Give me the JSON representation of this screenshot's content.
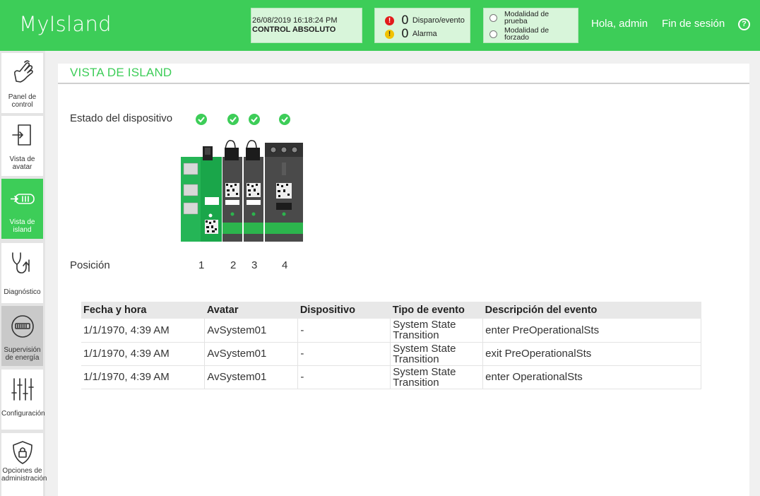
{
  "header": {
    "app_title": "MyIsland",
    "datetime": "26/08/2019 16:18:24 PM",
    "control_mode": "CONTROL ABSOLUTO",
    "trip_count": "0",
    "trip_label": "Disparo/evento",
    "alarm_count": "0",
    "alarm_label": "Alarma",
    "test_mode_label": "Modalidad de prueba",
    "forced_mode_label": "Modalidad de forzado",
    "greeting": "Hola, admin",
    "logout_label": "Fin de sesión",
    "help_icon": "?",
    "colors": {
      "brand": "#3dcd58",
      "trip": "#e21b1b",
      "alarm": "#f2c200"
    }
  },
  "sidebar": {
    "items": [
      {
        "label": "Panel de control",
        "icon": "hand-pointer-icon"
      },
      {
        "label": "Vista de avatar",
        "icon": "enter-door-icon"
      },
      {
        "label": "Vista de island",
        "icon": "island-module-icon",
        "active": true
      },
      {
        "label": "Diagnóstico",
        "icon": "stethoscope-icon"
      },
      {
        "label": "Supervisión de energía",
        "icon": "energy-meter-icon"
      },
      {
        "label": "Configuración",
        "icon": "sliders-icon"
      },
      {
        "label": "Opciones de administración",
        "icon": "shield-lock-icon"
      }
    ]
  },
  "main": {
    "title": "VISTA DE ISLAND",
    "device_state_label": "Estado del dispositivo",
    "position_label": "Posición",
    "positions": [
      "1",
      "2",
      "3",
      "4"
    ],
    "device_status": [
      "ok",
      "ok",
      "ok",
      "ok"
    ]
  },
  "events_table": {
    "headers": [
      "Fecha y hora",
      "Avatar",
      "Dispositivo",
      "Tipo de evento",
      "Descripción del evento"
    ],
    "rows": [
      [
        "1/1/1970, 4:39 AM",
        "AvSystem01",
        "-",
        "System State Transition",
        "enter PreOperationalSts"
      ],
      [
        "1/1/1970, 4:39 AM",
        "AvSystem01",
        "-",
        "System State Transition",
        "exit PreOperationalSts"
      ],
      [
        "1/1/1970, 4:39 AM",
        "AvSystem01",
        "-",
        "System State Transition",
        "enter OperationalSts"
      ]
    ]
  }
}
